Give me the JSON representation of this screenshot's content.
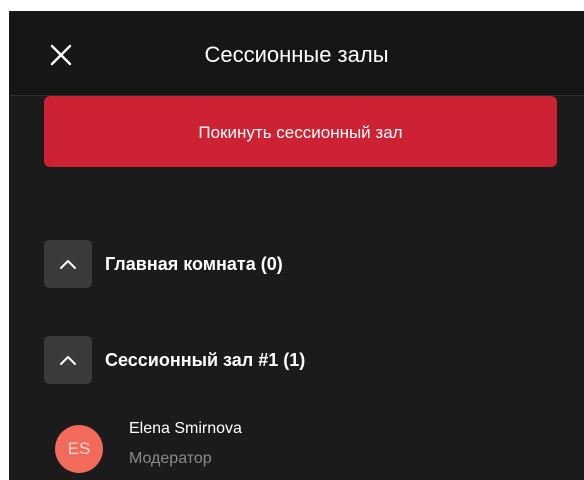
{
  "header": {
    "title": "Сессионные залы",
    "close_icon": "close-icon"
  },
  "leave_button": {
    "label": "Покинуть сессионный зал",
    "color": "#cc2233"
  },
  "rooms": [
    {
      "title": "Главная комната (0)",
      "toggle_icon": "chevron-up-icon"
    },
    {
      "title": "Сессионный зал #1 (1)",
      "toggle_icon": "chevron-up-icon"
    }
  ],
  "participants": [
    {
      "initials": "ES",
      "name": "Elena Smirnova",
      "role": "Модератор",
      "avatar_color": "#f26a5c"
    }
  ]
}
